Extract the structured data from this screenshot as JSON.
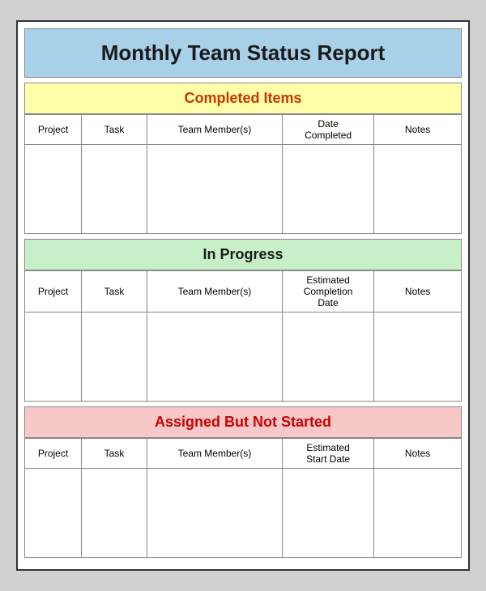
{
  "report": {
    "title": "Monthly Team Status Report",
    "sections": {
      "completed": {
        "header": "Completed Items",
        "columns": [
          "Project",
          "Task",
          "Team Member(s)",
          "Date\nCompleted",
          "Notes"
        ]
      },
      "inProgress": {
        "header": "In Progress",
        "columns": [
          "Project",
          "Task",
          "Team Member(s)",
          "Estimated\nCompletion\nDate",
          "Notes"
        ]
      },
      "assigned": {
        "header": "Assigned But Not Started",
        "columns": [
          "Project",
          "Task",
          "Team Member(s)",
          "Estimated\nStart Date",
          "Notes"
        ]
      }
    }
  }
}
